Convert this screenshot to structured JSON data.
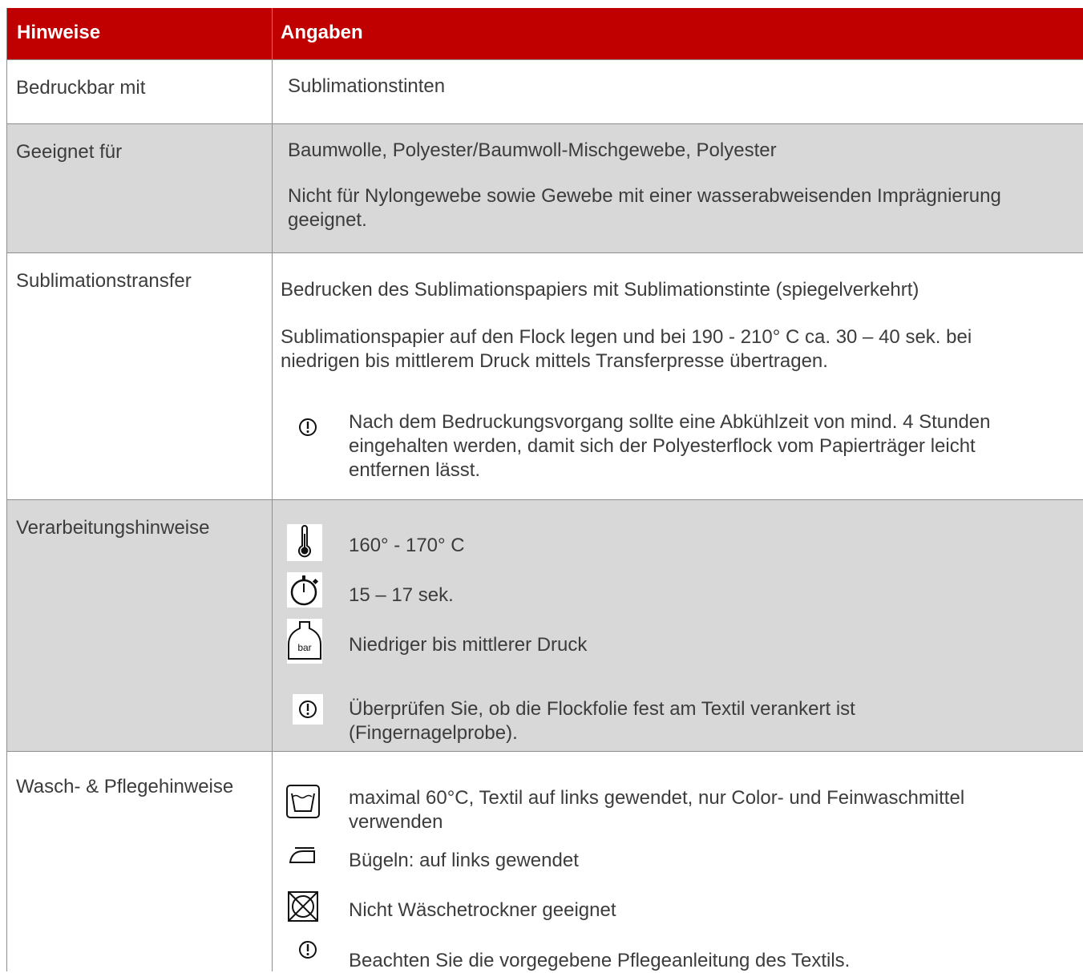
{
  "header": {
    "col1": "Hinweise",
    "col2": "Angaben"
  },
  "rows": {
    "bedruckbar": {
      "label": "Bedruckbar mit",
      "value": "Sublimationstinten"
    },
    "geeignet": {
      "label": "Geeignet für",
      "line1": "Baumwolle, Polyester/Baumwoll-Mischgewebe, Polyester",
      "line2a": "Nicht für Nylongewebe sowie Gewebe mit einer wasserabweisenden Imprägnierung",
      "line2b": "geeignet."
    },
    "transfer": {
      "label": "Sublimationstransfer",
      "line1": "Bedrucken des Sublimationspapiers mit Sublimationstinte (spiegelverkehrt)",
      "line2a": "Sublimationspapier auf den Flock legen und bei 190 - 210° C ca. 30 – 40 sek. bei",
      "line2b": "niedrigen bis mittlerem Druck mittels Transferpresse übertragen.",
      "note_a": "Nach dem Bedruckungsvorgang sollte eine Abkühlzeit von mind. 4 Stunden",
      "note_b": "eingehalten werden, damit sich der Polyesterflock vom Papierträger leicht",
      "note_c": "entfernen lässt."
    },
    "verarbeitung": {
      "label": "Verarbeitungshinweise",
      "temp": "160° - 170° C",
      "time": "15 – 17 sek.",
      "pressure": "Niedriger bis mittlerer Druck",
      "pressure_icon_text": "bar",
      "note_a": "Überprüfen Sie, ob die Flockfolie fest am Textil verankert ist",
      "note_b": "(Fingernagelprobe)."
    },
    "pflege": {
      "label": "Wasch- & Pflegehinweise",
      "wash_a": "maximal 60°C, Textil auf links gewendet, nur Color- und Feinwaschmittel",
      "wash_b": "verwenden",
      "iron": "Bügeln: auf links gewendet",
      "dryer": "Nicht Wäschetrockner geeignet",
      "note": "Beachten Sie die vorgegebene Pflegeanleitung des Textils."
    }
  },
  "colors": {
    "header_bg": "#c00000",
    "row_grey": "#d8d8d8",
    "border": "#8e8e8e",
    "text": "#3c3c3c"
  },
  "icons": [
    "exclamation-icon",
    "thermometer-icon",
    "stopwatch-icon",
    "pressure-weight-icon",
    "wash-tub-icon",
    "iron-icon",
    "no-tumble-dry-icon"
  ]
}
